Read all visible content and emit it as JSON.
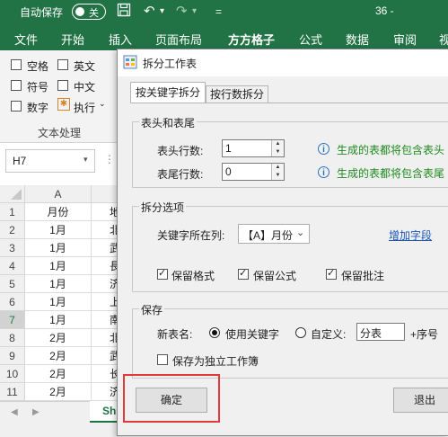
{
  "titlebar": {
    "autosave_label": "自动保存",
    "autosave_state": "关",
    "page_indicator": "36 -"
  },
  "tabs": [
    "文件",
    "开始",
    "插入",
    "页面布局",
    "方方格子",
    "公式",
    "数据",
    "审阅",
    "视"
  ],
  "ribbon": {
    "checks": [
      {
        "label": "空格",
        "checked": false
      },
      {
        "label": "英文",
        "checked": false
      },
      {
        "label": "符号",
        "checked": false
      },
      {
        "label": "中文",
        "checked": false
      },
      {
        "label": "数字",
        "checked": false
      }
    ],
    "execute_label": "执行",
    "group_label": "文本处理"
  },
  "namebox": "H7",
  "grid": {
    "col_a": "A",
    "row_numbers": [
      "1",
      "2",
      "3",
      "4",
      "5",
      "6",
      "7",
      "8",
      "9",
      "10",
      "11"
    ],
    "col_a_values": [
      "月份",
      "1月",
      "1月",
      "1月",
      "1月",
      "1月",
      "1月",
      "2月",
      "2月",
      "2月",
      "2月"
    ],
    "col_b_values": [
      "地",
      "北",
      "武",
      "長",
      "济",
      "上",
      "南",
      "北",
      "武",
      "长",
      "济"
    ],
    "sheet_tab": "Sh"
  },
  "dialog": {
    "title": "拆分工作表",
    "tabs": [
      "按关键字拆分",
      "按行数拆分"
    ],
    "header_group": {
      "title": "表头和表尾",
      "header_rows_label": "表头行数:",
      "header_rows_value": "1",
      "footer_rows_label": "表尾行数:",
      "footer_rows_value": "0",
      "header_note": "生成的表都将包含表头",
      "footer_note": "生成的表都将包含表尾"
    },
    "options_group": {
      "title": "拆分选项",
      "keyword_col_label": "关键字所在列:",
      "keyword_col_value": "【A】月份",
      "add_field_link": "增加字段",
      "keep_format": "保留格式",
      "keep_formula": "保留公式",
      "keep_comment": "保留批注"
    },
    "save_group": {
      "title": "保存",
      "new_name_label": "新表名:",
      "use_keyword": "使用关键字",
      "custom": "自定义:",
      "custom_value": "分表",
      "suffix": "+序号",
      "save_separate": "保存为独立工作簿"
    },
    "ok_label": "确定",
    "exit_label": "退出"
  },
  "colors": {
    "excel_green": "#217346",
    "highlight_red": "#e03a3a",
    "link_blue": "#1a56b4",
    "note_green": "#1f8a1f"
  }
}
